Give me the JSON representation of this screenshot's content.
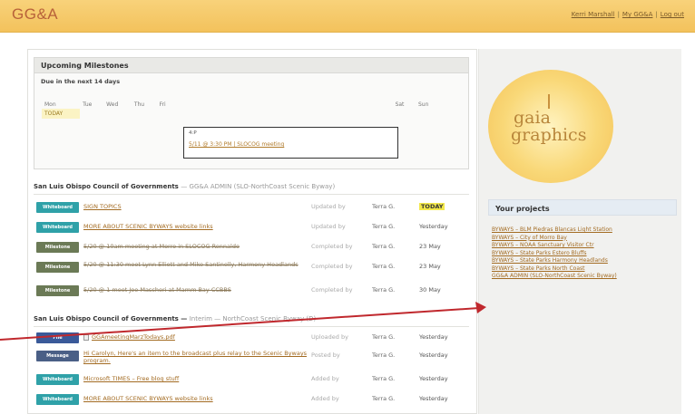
{
  "app": {
    "brand": "GG&A",
    "user_links": [
      "Kerri Marshall",
      "My GG&A",
      "Log out"
    ],
    "separator": "|"
  },
  "milestones": {
    "title": "Upcoming Milestones",
    "subtitle": "Due in the next 14 days",
    "days": [
      "Mon",
      "Tue",
      "Wed",
      "Thu",
      "Fri",
      "",
      "",
      "",
      "",
      "",
      "Sat",
      "Sun"
    ],
    "today_label": "TODAY",
    "event": {
      "time": "4:P",
      "link": "5/11 @ 3:30 PM | SLOCOG meeting"
    }
  },
  "sections": [
    {
      "title": "San Luis Obispo Council of Governments",
      "subtitle": "— GG&A ADMIN (SLO-NorthCoast Scenic Byway)"
    },
    {
      "title": "San Luis Obispo Council of Governments —",
      "subtitle": "Interim — NorthCoast Scenic Byway (D)"
    }
  ],
  "rows1": [
    {
      "badge": "Whiteboard",
      "title": "SIGN TOPICS",
      "meta": "Updated by",
      "who": "Terra G.",
      "when": "TODAY",
      "today": true
    },
    {
      "badge": "Whiteboard",
      "title": "MORE ABOUT SCENIC BYWAYS website links",
      "meta": "Updated by",
      "who": "Terra G.",
      "when": "Yesterday"
    },
    {
      "badge": "Milestone",
      "title": "5/20 @ 10am meeting at Morro in SLOCOG Rennaldo",
      "meta": "Completed by",
      "who": "Terra G.",
      "when": "23 May"
    },
    {
      "badge": "Milestone",
      "title": "5/20 @ 11:30 meet Lynn Elliott and Mike Santinelly, Harmony Headlands",
      "meta": "Completed by",
      "who": "Terra G.",
      "when": "23 May"
    },
    {
      "badge": "Milestone",
      "title": "5/20 @ 1 meet Joe Mascheri at Mamm Bay CCBBS",
      "meta": "Completed by",
      "who": "Terra G.",
      "when": "30 May"
    }
  ],
  "rows2": [
    {
      "badge": "File",
      "title": "GGAmeetingMarzTodays.pdf",
      "meta": "Uploaded by",
      "who": "Terra G.",
      "when": "Yesterday"
    },
    {
      "badge": "Message",
      "title": "Hi Carolyn, Here's an item to the broadcast plus relay to the Scenic Byways program.",
      "meta": "Posted by",
      "who": "Terra G.",
      "when": "Yesterday"
    },
    {
      "badge": "Whiteboard",
      "title": "Microsoft TIMES – Free blog stuff",
      "meta": "Added by",
      "who": "Terra G.",
      "when": "Yesterday"
    },
    {
      "badge": "Whiteboard",
      "title": "MORE ABOUT SCENIC BYWAYS website links",
      "meta": "Added by",
      "who": "Terra G.",
      "when": "Yesterday"
    }
  ],
  "logo": {
    "line1": "gaia",
    "line2": "graphics"
  },
  "projects": {
    "heading": "Your projects",
    "items": [
      "BYWAYS – BLM Piedras Blancas Light Station",
      "BYWAYS – City of Morro Bay",
      "BYWAYS – NOAA Sanctuary Visitor Ctr",
      "BYWAYS – State Parks Estero Bluffs",
      "BYWAYS – State Parks Harmony Headlands",
      "BYWAYS – State Parks North Coast",
      "GG&A ADMIN (SLO-NorthCoast Scenic Byway)"
    ]
  },
  "colors": {
    "accent": "#f3c25c",
    "link": "#a36b22",
    "arrow": "#c0282d"
  }
}
